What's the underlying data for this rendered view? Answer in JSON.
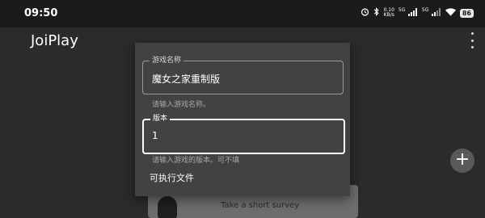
{
  "status_bar": {
    "time": "09:50",
    "net_speed_top": "0.10",
    "net_speed_unit": "KB/s",
    "signal1_tag": "5G",
    "signal2_tag": "5G",
    "battery": "86",
    "icons": [
      "alarm-icon",
      "bluetooth-icon",
      "signal-icon",
      "signal-icon",
      "wifi-icon",
      "battery-icon"
    ]
  },
  "app_bar": {
    "title": "JoiPlay",
    "menu_icon": "more-vert-icon"
  },
  "fab": {
    "icon": "plus-icon",
    "glyph": "+"
  },
  "survey_banner": {
    "text": "Take a short survey"
  },
  "dialog": {
    "name_field": {
      "label": "游戏名称",
      "value": "魔女之家重制版",
      "helper": "请输入游戏名称。"
    },
    "version_field": {
      "label": "版本",
      "value": "1",
      "helper": "请输入游戏的版本。可不填"
    },
    "executable_label": "可执行文件"
  }
}
